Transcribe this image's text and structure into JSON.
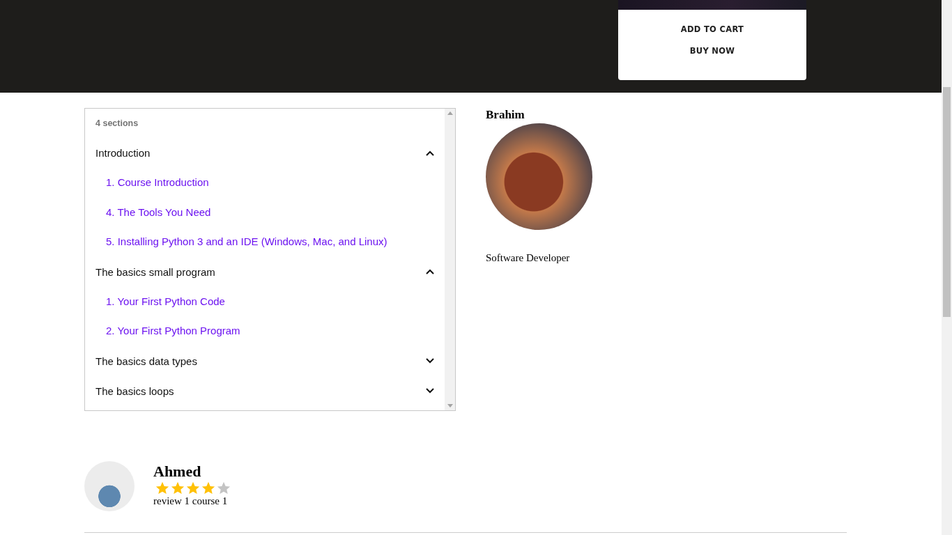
{
  "purchase_card": {
    "buttons": [
      "ADD TO CART",
      "BUY NOW"
    ]
  },
  "curriculum": {
    "count": "4 sections",
    "sections": [
      {
        "title": "Introduction",
        "expanded": true,
        "lessons": [
          "1. Course Introduction",
          "4. The Tools You Need",
          "5. Installing Python 3 and an IDE (Windows, Mac, and Linux)"
        ]
      },
      {
        "title": "The basics small program",
        "expanded": true,
        "lessons": [
          "1. Your First Python Code",
          "2. Your First Python Program"
        ]
      },
      {
        "title": "The basics data types",
        "expanded": false
      },
      {
        "title": "The basics loops",
        "expanded": false
      }
    ]
  },
  "instructor": {
    "name": "Brahim",
    "role": "Software Developer"
  },
  "reviews": [
    {
      "name": "Ahmed",
      "stars": 4,
      "text": "review 1 course 1"
    }
  ]
}
